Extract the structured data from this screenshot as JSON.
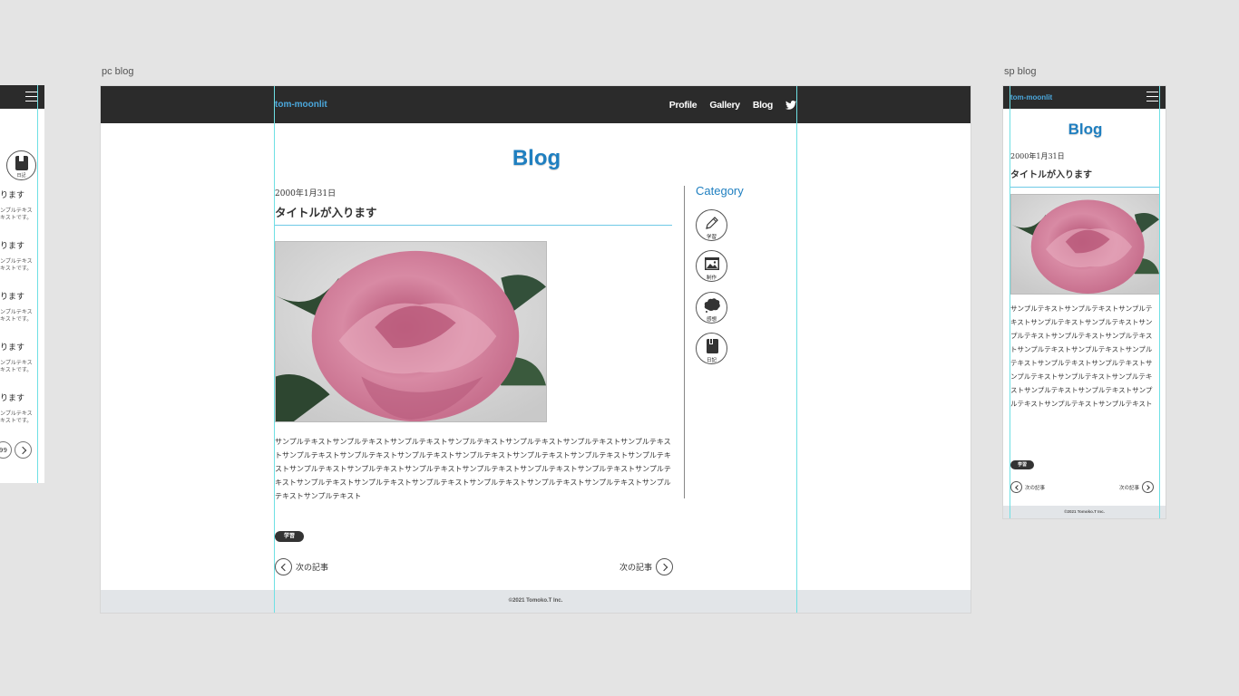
{
  "artboards": {
    "pc_label": "pc blog",
    "sp_label": "sp blog"
  },
  "colors": {
    "header_bg": "#2b2b2b",
    "brand": "#4ba8dd",
    "title": "#1f7fc0",
    "guide": "#6ee0e4",
    "footer_bg": "#e2e5e8"
  },
  "site": {
    "logo": "tom-moonlit",
    "nav": [
      "Profile",
      "Gallery",
      "Blog"
    ],
    "twitter_icon": "twitter-icon",
    "footer": "©2021 Tomoko.T Inc."
  },
  "page": {
    "title": "Blog"
  },
  "post": {
    "date": "2000年1月31日",
    "title": "タイトルが入ります",
    "body_pc": "サンプルテキストサンプルテキストサンプルテキストサンプルテキストサンプルテキストサンプルテキストサンプルテキストサンプルテキストサンプルテキストサンプルテキストサンプルテキストサンプルテキストサンプルテキストサンプルテキストサンプルテキストサンプルテキストサンプルテキストサンプルテキストサンプルテキストサンプルテキストサンプルテキストサンプルテキストサンプルテキストサンプルテキストサンプルテキストサンプルテキストサンプルテキストサンプルテキストサンプルテキスト",
    "body_sp": "サンプルテキストサンプルテキストサンプルテキストサンプルテキストサンプルテキストサンプルテキストサンプルテキストサンプルテキストサンプルテキストサンプルテキストサンプルテキストサンプルテキストサンプルテキストサンプルテキストサンプルテキストサンプルテキストサンプルテキストサンプルテキストサンプルテキストサンプルテキストサンプルテキスト",
    "tag": "学習",
    "prev_label": "次の記事",
    "next_label": "次の記事"
  },
  "sidebar": {
    "heading": "Category",
    "categories": [
      {
        "label": "学習",
        "icon": "pencil-icon"
      },
      {
        "label": "制作",
        "icon": "image-icon"
      },
      {
        "label": "感想",
        "icon": "thought-cloud-icon"
      },
      {
        "label": "日記",
        "icon": "notebook-icon"
      }
    ]
  },
  "left_partial": {
    "category_label": "日記",
    "items": [
      {
        "title": "ります",
        "text1": "ンプルテキス",
        "text2": "キストです。"
      },
      {
        "title": "ります",
        "text1": "ンプルテキス",
        "text2": "キストです。"
      },
      {
        "title": "ります",
        "text1": "ンプルテキス",
        "text2": "キストです。"
      },
      {
        "title": "ります",
        "text1": "ンプルテキス",
        "text2": "キストです。"
      },
      {
        "title": "ります",
        "text1": "ンプルテキス",
        "text2": "キストです。"
      }
    ],
    "pager_last": "99"
  }
}
